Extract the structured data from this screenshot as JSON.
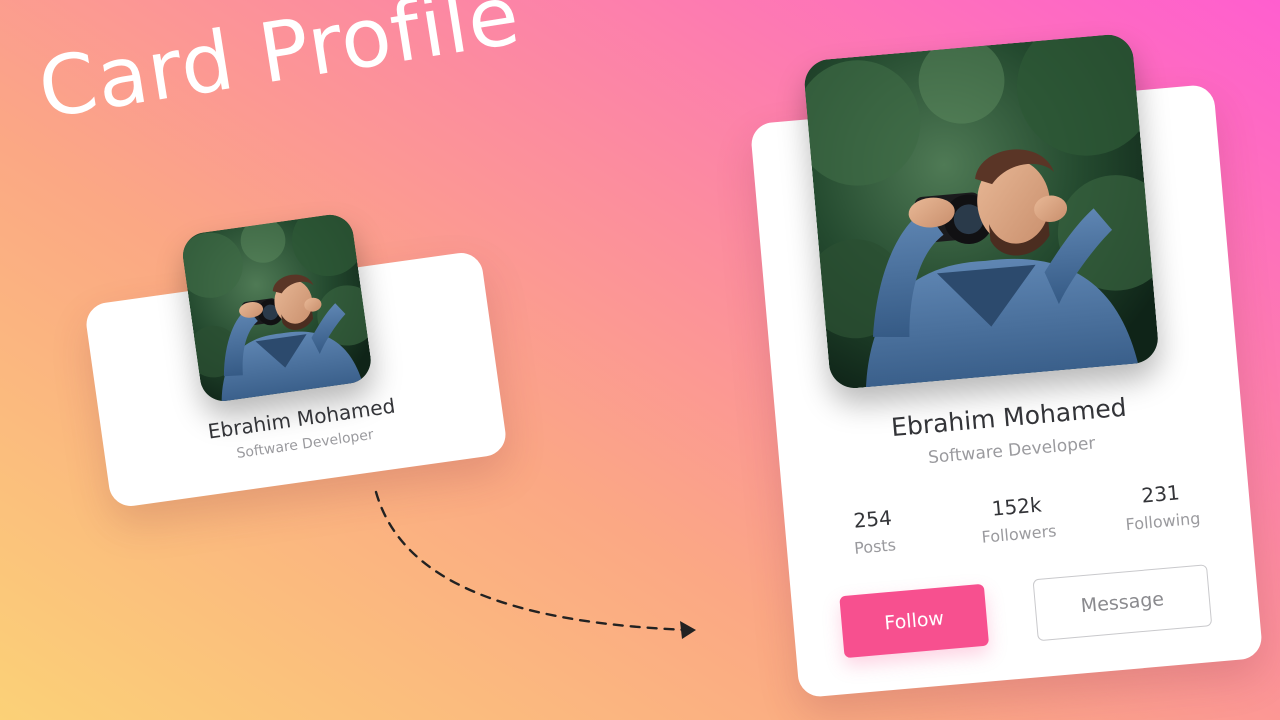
{
  "title": "Card Profile",
  "colors": {
    "accent": "#f7508f",
    "text_primary": "#333438",
    "text_secondary": "#9a9a9e"
  },
  "small_card": {
    "name": "Ebrahim Mohamed",
    "role": "Software Developer"
  },
  "large_card": {
    "name": "Ebrahim Mohamed",
    "role": "Software Developer",
    "stats": [
      {
        "value": "254",
        "label": "Posts"
      },
      {
        "value": "152k",
        "label": "Followers"
      },
      {
        "value": "231",
        "label": "Following"
      }
    ],
    "follow_label": "Follow",
    "message_label": "Message"
  },
  "icons": {
    "arrow": "dashed-arrow-icon",
    "photo": "profile-photo"
  }
}
